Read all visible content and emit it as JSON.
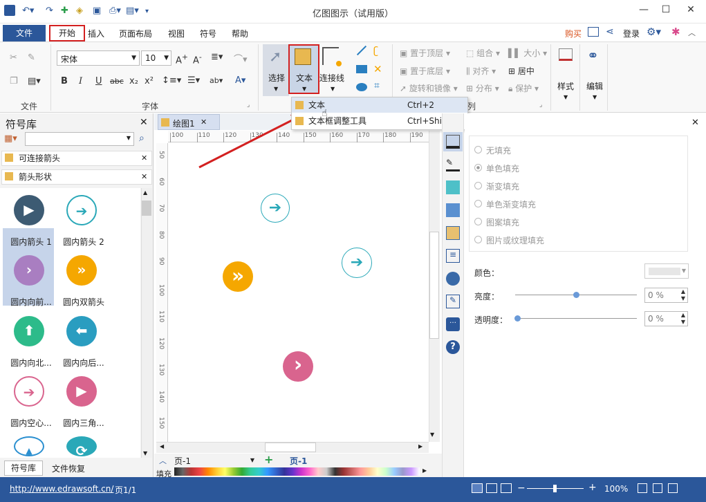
{
  "window": {
    "title": "亿图图示（试用版）",
    "minimize": "—",
    "maximize": "☐",
    "close": "✕"
  },
  "quick_access": [
    "≡",
    "↶▾",
    "↷",
    "✚",
    "◈",
    "▣",
    "⎙▾",
    "▤▾",
    "▾"
  ],
  "menu": {
    "file": "文件",
    "items": [
      "开始",
      "插入",
      "页面布局",
      "视图",
      "符号",
      "帮助"
    ],
    "right": {
      "buy": "购买",
      "login": "登录"
    }
  },
  "ribbon": {
    "groups": {
      "file": "文件",
      "font": "字体",
      "arrange_tail": "列"
    },
    "font_name": "宋体",
    "font_size": "10",
    "select": "选择",
    "text": "文本",
    "connector": "连接线",
    "bring_front": "置于顶层",
    "send_back": "置于底层",
    "rotate_mirror": "旋转和镜像",
    "group": "组合",
    "align": "对齐",
    "distribute": "分布",
    "size": "大小",
    "center": "居中",
    "protect": "保护",
    "style": "样式",
    "edit": "编辑"
  },
  "dropdown": {
    "items": [
      {
        "label": "文本",
        "shortcut": "Ctrl+2"
      },
      {
        "label": "文本框调整工具",
        "shortcut": "Ctrl+Shift+2"
      }
    ]
  },
  "library": {
    "title": "符号库",
    "open_libs": [
      "可连接箭头",
      "箭头形状"
    ],
    "symbols": [
      {
        "label": "圆内箭头 1",
        "color": "#3d5b73",
        "glyph": "▶",
        "style": "filled"
      },
      {
        "label": "圆内箭头 2",
        "color": "#2aa8b8",
        "glyph": "➔",
        "style": "outline"
      },
      {
        "label": "圆内向前...",
        "color": "#a97ec1",
        "glyph": "›",
        "style": "filled"
      },
      {
        "label": "圆内双箭头",
        "color": "#f5a700",
        "glyph": "»",
        "style": "filled"
      },
      {
        "label": "圆内向北...",
        "color": "#2dbb8a",
        "glyph": "⬆",
        "style": "filled"
      },
      {
        "label": "圆内向后...",
        "color": "#2a9dc0",
        "glyph": "⬅",
        "style": "filled"
      },
      {
        "label": "圆内空心...",
        "color": "#d9648e",
        "glyph": "➔",
        "style": "outline"
      },
      {
        "label": "圆内三角...",
        "color": "#d9648e",
        "glyph": "▶",
        "style": "filled"
      },
      {
        "label": "",
        "color": "#2a8fd0",
        "glyph": "▲",
        "style": "outline"
      },
      {
        "label": "",
        "color": "#2aa8b8",
        "glyph": "⟳",
        "style": "filled"
      }
    ],
    "tabs": [
      "符号库",
      "文件恢复"
    ]
  },
  "document": {
    "tab": "绘图1",
    "page_tab": "页-1",
    "page_label": "页-1",
    "fill_label": "填充"
  },
  "ruler": {
    "top": [
      "100",
      "110",
      "120",
      "130",
      "140",
      "150",
      "160",
      "170",
      "180",
      "190"
    ],
    "left": [
      "50",
      "60",
      "70",
      "80",
      "90",
      "100",
      "110",
      "120",
      "130",
      "140",
      "150"
    ]
  },
  "fill_panel": {
    "options": [
      "无填充",
      "单色填充",
      "渐变填充",
      "单色渐变填充",
      "图案填充",
      "图片或纹理填充"
    ],
    "selected": "单色填充",
    "color_label": "颜色：",
    "brightness_label": "亮度：",
    "transparency_label": "透明度：",
    "brightness": "0 %",
    "transparency": "0 %"
  },
  "status": {
    "url": "http://www.edrawsoft.cn/",
    "page": "页1/1",
    "zoom": "100%"
  }
}
